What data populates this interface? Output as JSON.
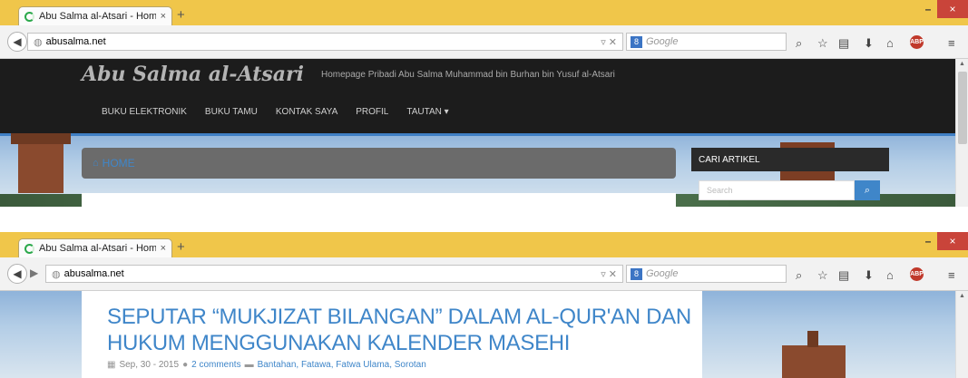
{
  "browser": {
    "tab_title": "Abu Salma al-Atsari - Hom...",
    "tab_close": "×",
    "new_tab": "+",
    "url": "abusalma.net",
    "search_placeholder": "Google",
    "search_engine_glyph": "8",
    "window_controls": {
      "minimize": "–",
      "maximize": "□",
      "close": "×"
    },
    "toolbar_icons": [
      "search-icon",
      "star-icon",
      "reading-list-icon",
      "download-icon",
      "home-icon",
      "adblock-icon",
      "menu-icon"
    ],
    "adblock_label": "ABP"
  },
  "site": {
    "brand": "Abu Salma al-Atsari",
    "tagline": "Homepage Pribadi Abu Salma Muhammad bin Burhan bin Yusuf al-Atsari",
    "menu": [
      "BUKU ELEKTRONIK",
      "BUKU TAMU",
      "KONTAK SAYA",
      "PROFIL",
      "TAUTAN ▾"
    ],
    "breadcrumb": "HOME",
    "sidebar_title": "CARI ARTIKEL",
    "sidebar_search_placeholder": "Search"
  },
  "post": {
    "title": "SEPUTAR “MUKJIZAT BILANGAN” DALAM AL-QUR'AN DAN HUKUM MENGGUNAKAN KALENDER MASEHI",
    "date": "Sep, 30 - 2015",
    "comments": "2 comments",
    "categories": "Bantahan, Fatawa, Fatwa Ulama, Sorotan"
  },
  "colors": {
    "accent": "#3f86c9",
    "titlebar": "#f0c64a",
    "header": "#1c1c1c"
  }
}
